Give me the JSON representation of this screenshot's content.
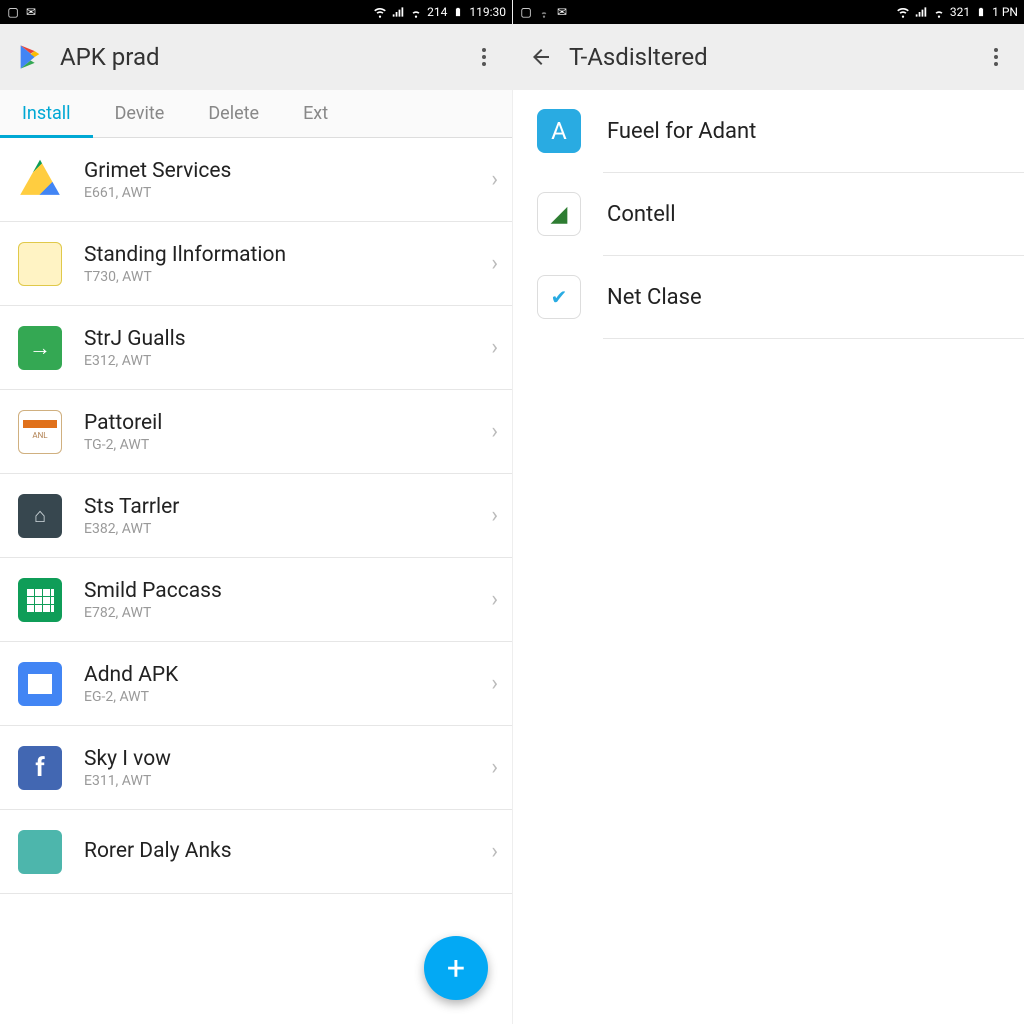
{
  "left": {
    "status": {
      "num": "214",
      "time": "119:30"
    },
    "appbar_title": "APK prad",
    "tabs": [
      {
        "label": "Install",
        "active": true
      },
      {
        "label": "Devite",
        "active": false
      },
      {
        "label": "Delete",
        "active": false
      },
      {
        "label": "Ext",
        "active": false
      }
    ],
    "rows": [
      {
        "name": "Grimet Services",
        "meta": "E661, AWT",
        "icon": "ic-drive"
      },
      {
        "name": "Standing Ilnformation",
        "meta": "T730, AWT",
        "icon": "ic-yellow"
      },
      {
        "name": "StrJ Gualls",
        "meta": "E312, AWT",
        "icon": "ic-green",
        "glyph": "→"
      },
      {
        "name": "Pattoreil",
        "meta": "TG-2, AWT",
        "icon": "ic-box",
        "glyph": "ANL"
      },
      {
        "name": "Sts Tarrler",
        "meta": "E382, AWT",
        "icon": "ic-dark",
        "glyph": "⌂"
      },
      {
        "name": "Smild Paccass",
        "meta": "E782, AWT",
        "icon": "ic-sheets"
      },
      {
        "name": "Adnd APK",
        "meta": "EG-2, AWT",
        "icon": "ic-docs"
      },
      {
        "name": "Sky I vow",
        "meta": "E311, AWT",
        "icon": "ic-fb",
        "glyph": "f"
      },
      {
        "name": "Rorer Daly Anks",
        "meta": "",
        "icon": "ic-teal"
      }
    ],
    "fab_glyph": "+"
  },
  "right": {
    "status": {
      "num": "321",
      "time": "1 PN"
    },
    "appbar_title": "T-Asdisltered",
    "rows": [
      {
        "label": "Fueel for Adant",
        "icon": "ic-appstore",
        "glyph": "A"
      },
      {
        "label": "Contell",
        "icon": "ic-leaf",
        "glyph": "◢"
      },
      {
        "label": "Net Clase",
        "icon": "ic-check",
        "glyph": "✔"
      }
    ]
  }
}
